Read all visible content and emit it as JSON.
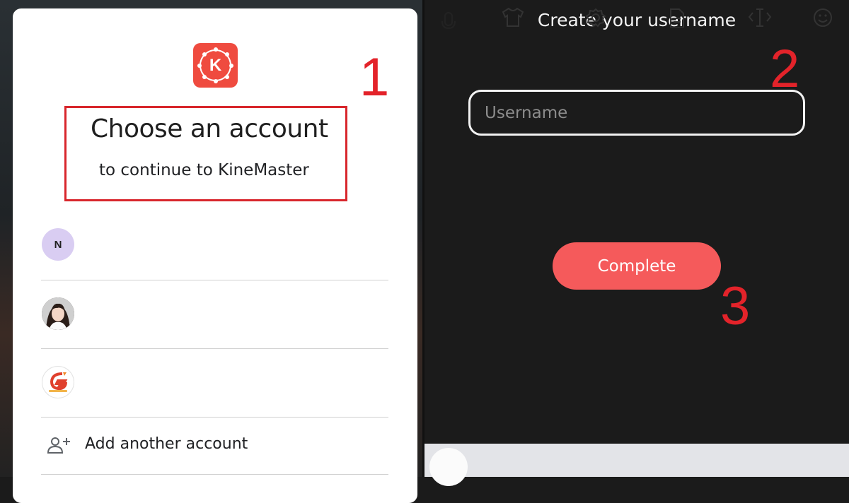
{
  "left_panel": {
    "app_logo_letter": "K",
    "title": "Choose an account",
    "subtitle": "to continue to KineMaster",
    "accounts": [
      {
        "avatar_letter": "N"
      },
      {
        "avatar_kind": "photo"
      },
      {
        "avatar_kind": "brand-logo"
      }
    ],
    "add_account_label": "Add another account",
    "step_number": "1"
  },
  "right_panel": {
    "title": "Create your username",
    "username_placeholder": "Username",
    "username_value": "",
    "complete_label": "Complete",
    "step_number_input": "2",
    "step_number_button": "3"
  },
  "keyboard_toolbar": {
    "icons": [
      "mic-icon",
      "shirt-icon",
      "gear-icon",
      "document-icon",
      "text-cursor-icon",
      "smiley-icon"
    ]
  },
  "colors": {
    "accent_red": "#e3232a",
    "complete_button": "#f55a5b",
    "kinemaster_logo": "#ef4b3f",
    "dark_background": "#1b1b1b"
  }
}
